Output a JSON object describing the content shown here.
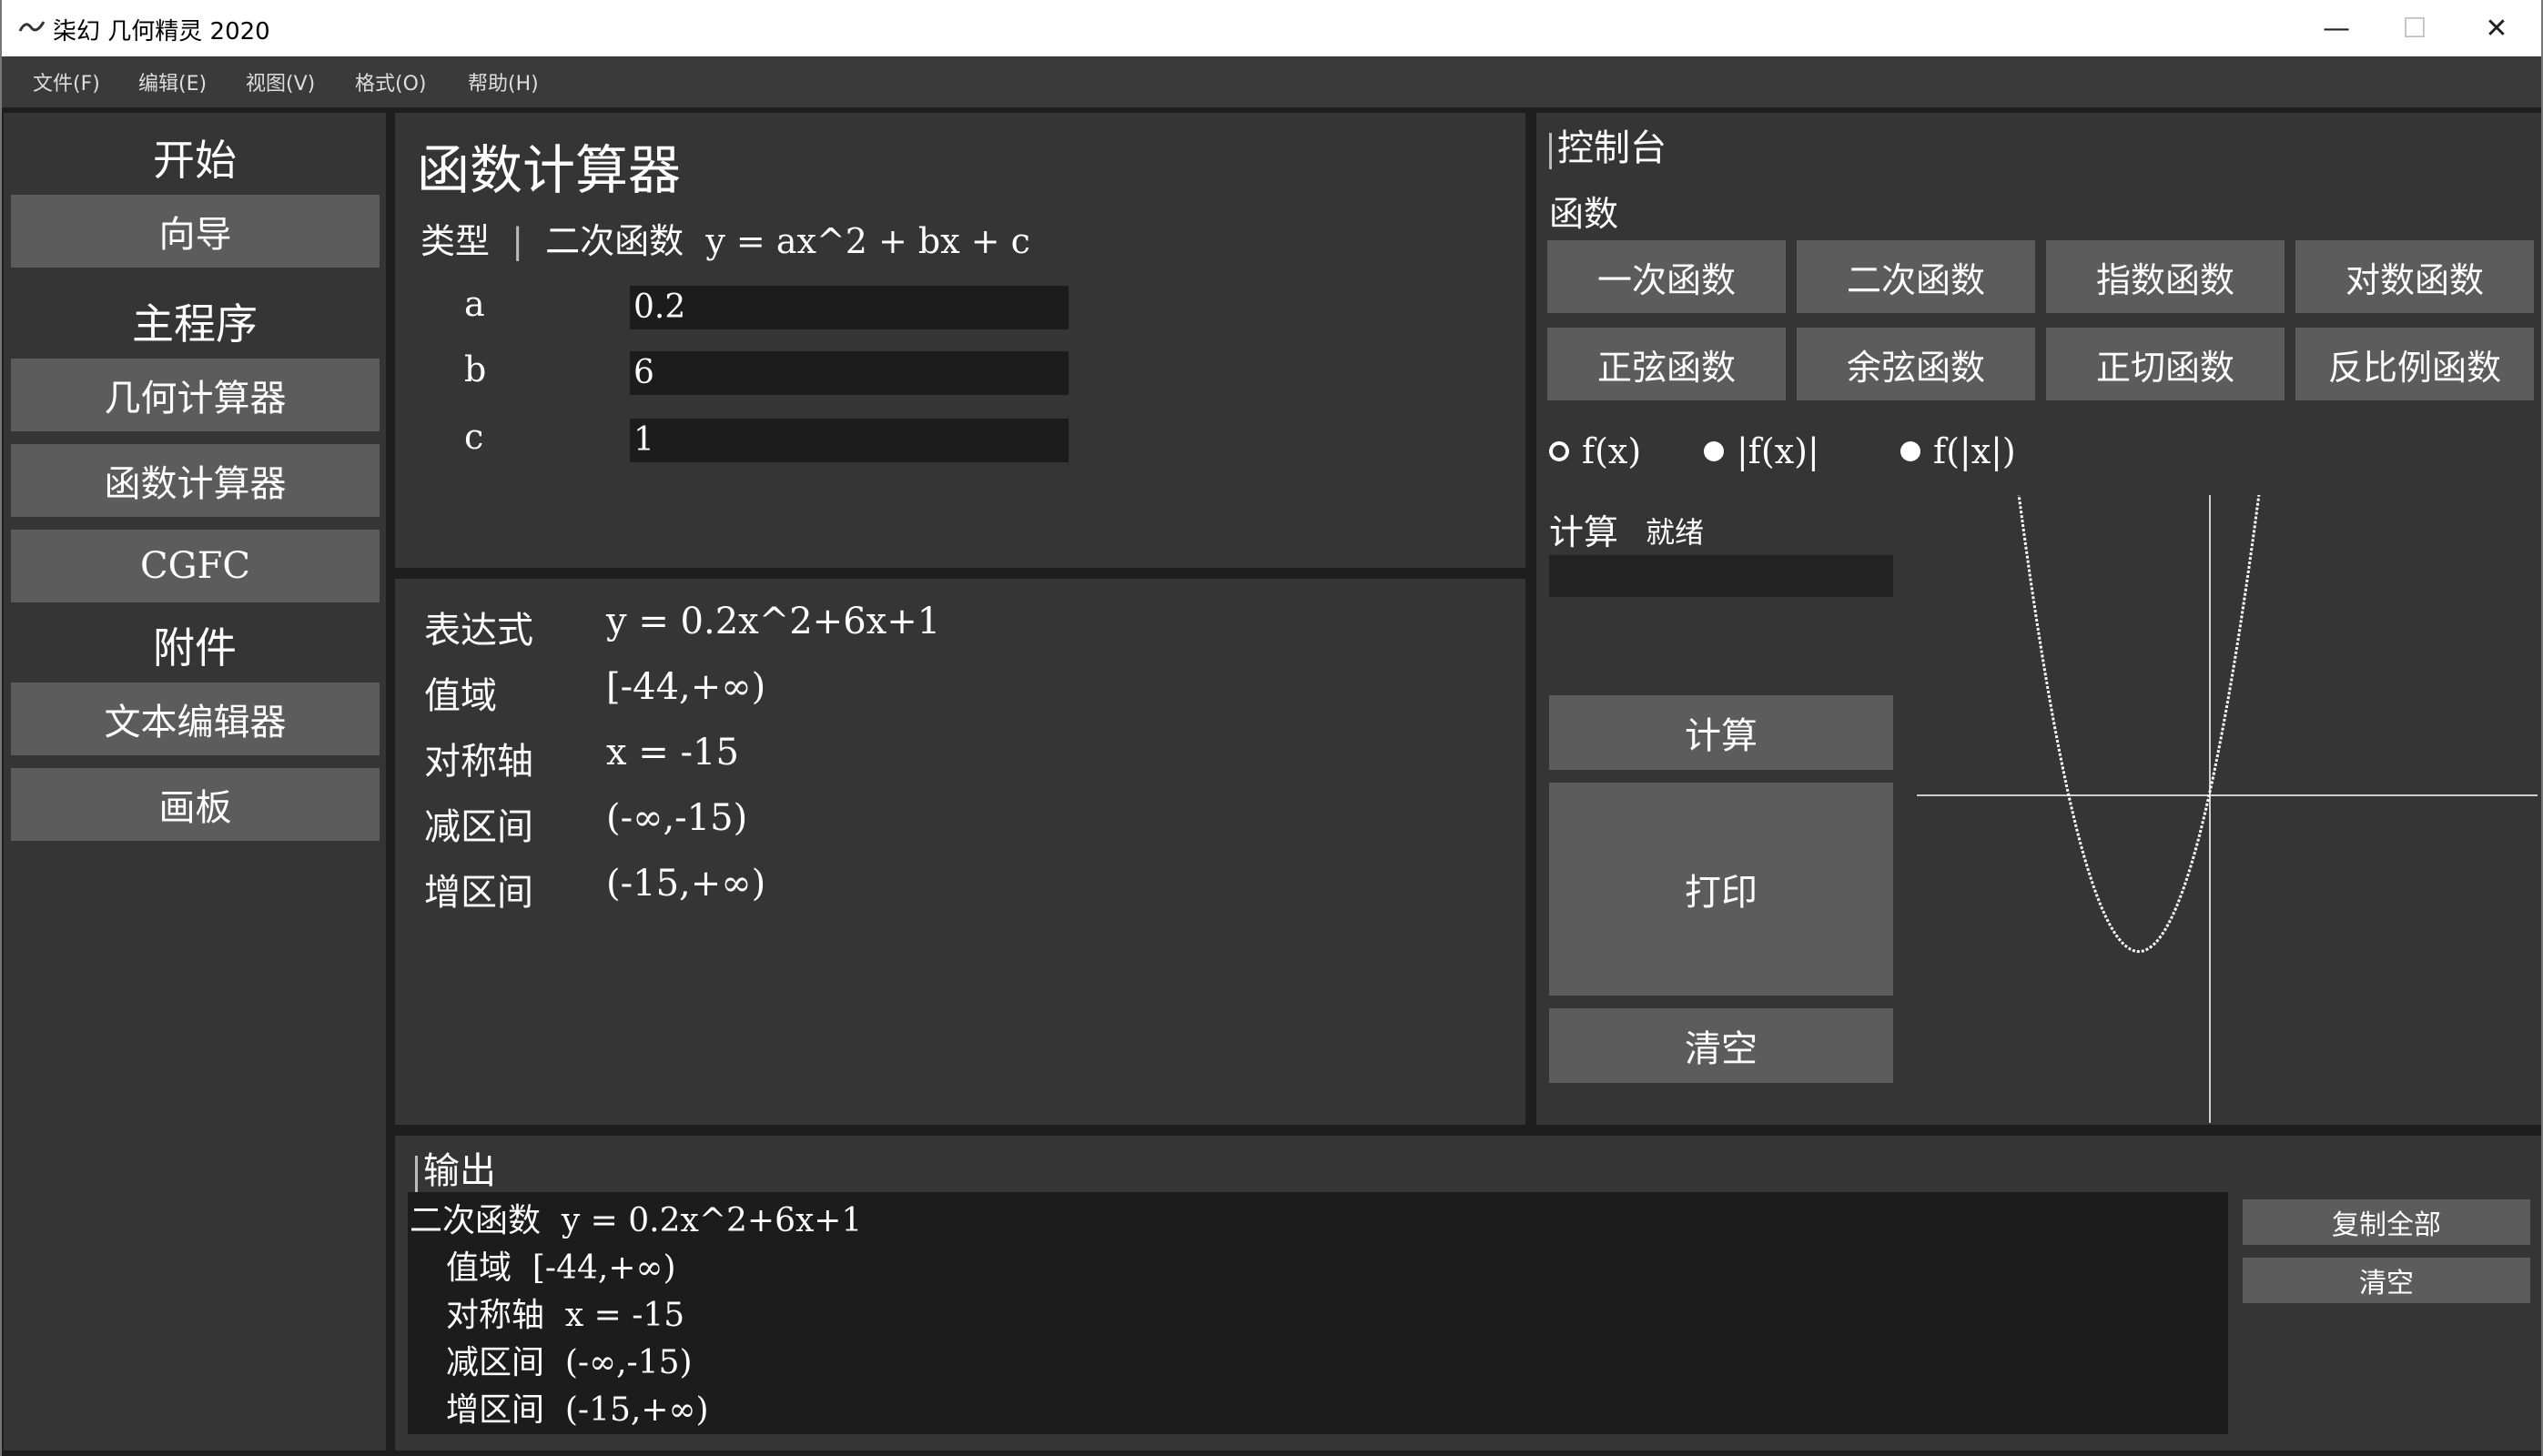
{
  "window": {
    "title": "柒幻 几何精灵 2020",
    "minimize": "—",
    "maximize": "☐",
    "close": "✕"
  },
  "menu": [
    "文件(F)",
    "编辑(E)",
    "视图(V)",
    "格式(O)",
    "帮助(H)"
  ],
  "sidebar": {
    "start_heading": "开始",
    "guide_button": "向导",
    "main_heading": "主程序",
    "geometry_button": "几何计算器",
    "function_button": "函数计算器",
    "cgfc_button": "CGFC",
    "attachments_heading": "附件",
    "text_editor_button": "文本编辑器",
    "canvas_button": "画板"
  },
  "calculator": {
    "title": "函数计算器",
    "type_label": "类型",
    "type_separator": "|",
    "type_value": "二次函数",
    "formula": "y = ax^2 + bx + c",
    "params": [
      {
        "label": "a",
        "value": "0.2"
      },
      {
        "label": "b",
        "value": "6"
      },
      {
        "label": "c",
        "value": "1"
      }
    ]
  },
  "results": [
    {
      "label": "表达式",
      "value": "y = 0.2x^2+6x+1"
    },
    {
      "label": "值域",
      "value": "[-44,+∞)"
    },
    {
      "label": "对称轴",
      "value": "x = -15"
    },
    {
      "label": "减区间",
      "value": "(-∞,-15)"
    },
    {
      "label": "增区间",
      "value": "(-15,+∞)"
    }
  ],
  "console": {
    "title": "控制台",
    "functions_label": "函数",
    "function_buttons": [
      "一次函数",
      "二次函数",
      "指数函数",
      "对数函数",
      "正弦函数",
      "余弦函数",
      "正切函数",
      "反比例函数"
    ],
    "modes": [
      {
        "label": "f(x)",
        "selected": true
      },
      {
        "label": "|f(x)|",
        "selected": false
      },
      {
        "label": "f(|x|)",
        "selected": false
      }
    ],
    "compute_label": "计算",
    "status": "就绪",
    "compute_button": "计算",
    "print_button": "打印",
    "clear_button": "清空"
  },
  "output": {
    "title": "输出",
    "lines": [
      "二次函数  y = 0.2x^2+6x+1",
      "值域  [-44,+∞)",
      "对称轴  x = -15",
      "减区间  (-∞,-15)",
      "增区间  (-15,+∞)"
    ],
    "copy_all_button": "复制全部",
    "clear_button": "清空"
  },
  "colors": {
    "background": "#1e1e1e",
    "panel": "#353535",
    "button": "#5c5c5c",
    "input": "#1c1c1c",
    "text": "#ffffff"
  }
}
